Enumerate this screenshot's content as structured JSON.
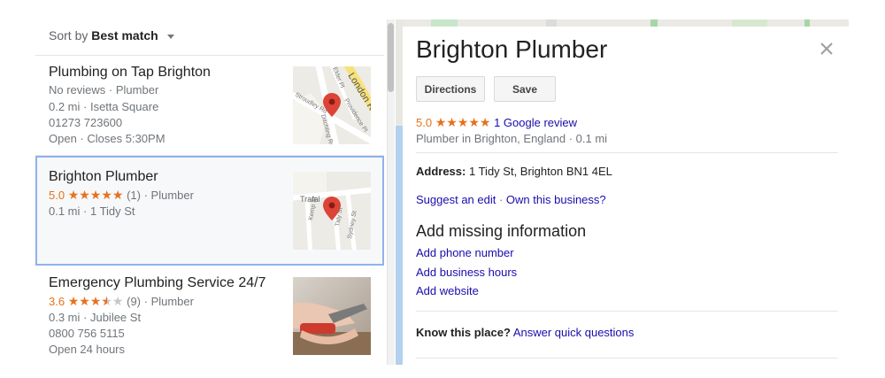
{
  "sort": {
    "prefix": "Sort by",
    "value": "Best match"
  },
  "results": [
    {
      "name": "Plumbing on Tap Brighton",
      "reviews": "No reviews",
      "category": "Plumber",
      "distance": "0.2 mi",
      "address": "Isetta Square",
      "phone": "01273 723600",
      "status": "Open",
      "hours": "Closes 5:30PM",
      "map_labels": [
        "London Rd",
        "Elder Pl",
        "Providence Pl",
        "Ditchling Rd",
        "Stroudley Rd"
      ]
    },
    {
      "name": "Brighton Plumber",
      "rating": "5.0",
      "stars": 5,
      "review_count": "(1)",
      "category": "Plumber",
      "distance": "0.1 mi",
      "address": "1 Tidy St",
      "map_labels": [
        "Trafal",
        "Kemp St",
        "Tidy St",
        "Sydney St"
      ]
    },
    {
      "name": "Emergency Plumbing Service 24/7",
      "rating": "3.6",
      "stars": 3.5,
      "review_count": "(9)",
      "category": "Plumber",
      "distance": "0.3 mi",
      "address": "Jubilee St",
      "phone": "0800 756 5115",
      "hours": "Open 24 hours"
    }
  ],
  "detail": {
    "title": "Brighton Plumber",
    "directions_label": "Directions",
    "save_label": "Save",
    "rating": "5.0",
    "stars": 5,
    "review_link": "1 Google review",
    "category": "Plumber in Brighton, England",
    "distance": "0.1 mi",
    "address_label": "Address:",
    "address_value": "1 Tidy St, Brighton BN1 4EL",
    "suggest_edit": "Suggest an edit",
    "own_business": "Own this business?",
    "missing_heading": "Add missing information",
    "add_phone": "Add phone number",
    "add_hours": "Add business hours",
    "add_website": "Add website",
    "know_label": "Know this place?",
    "know_link": "Answer quick questions"
  },
  "colors": {
    "star": "#e7711b",
    "link": "#1a0dab",
    "pin": "#db4437",
    "selected_border": "#8fb3ec"
  }
}
